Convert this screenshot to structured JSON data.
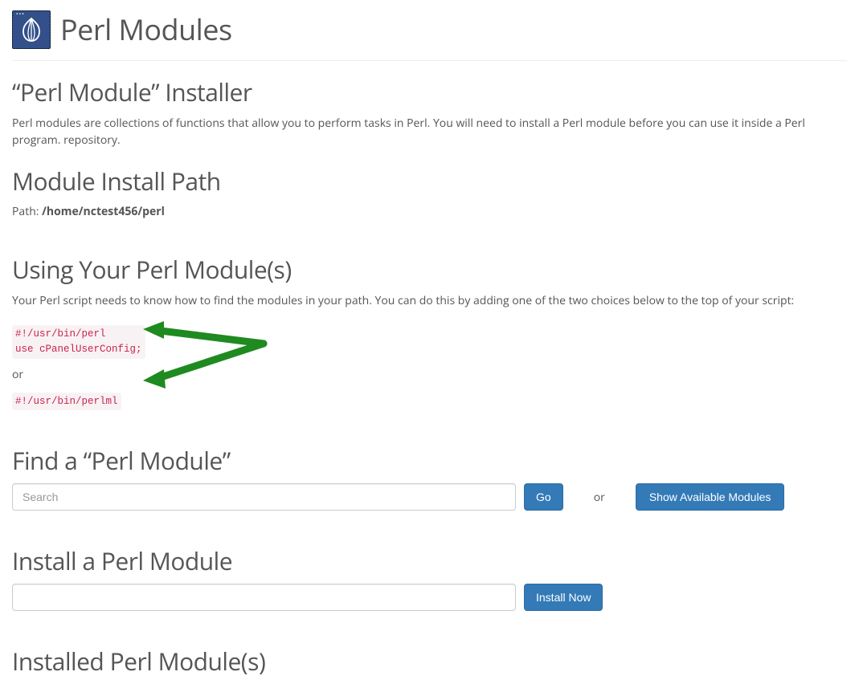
{
  "header": {
    "title": "Perl Modules",
    "icon": "perl-onion-icon"
  },
  "sections": {
    "installer": {
      "heading": "“Perl Module” Installer",
      "description": "Perl modules are collections of functions that allow you to perform tasks in Perl. You will need to install a Perl module before you can use it inside a Perl program. repository."
    },
    "path": {
      "heading": "Module Install Path",
      "label": "Path: ",
      "value": "/home/nctest456/perl"
    },
    "using": {
      "heading": "Using Your Perl Module(s)",
      "description": "Your Perl script needs to know how to find the modules in your path. You can do this by adding one of the two choices below to the top of your script:",
      "snippet1": "#!/usr/bin/perl\nuse cPanelUserConfig;",
      "or_text": "or",
      "snippet2": "#!/usr/bin/perlml"
    },
    "find": {
      "heading": "Find a “Perl Module”",
      "search_placeholder": "Search",
      "go_label": "Go",
      "or_text": "or",
      "show_available_label": "Show Available Modules"
    },
    "install": {
      "heading": "Install a Perl Module",
      "install_now_label": "Install Now"
    },
    "installed": {
      "heading": "Installed Perl Module(s)"
    }
  }
}
